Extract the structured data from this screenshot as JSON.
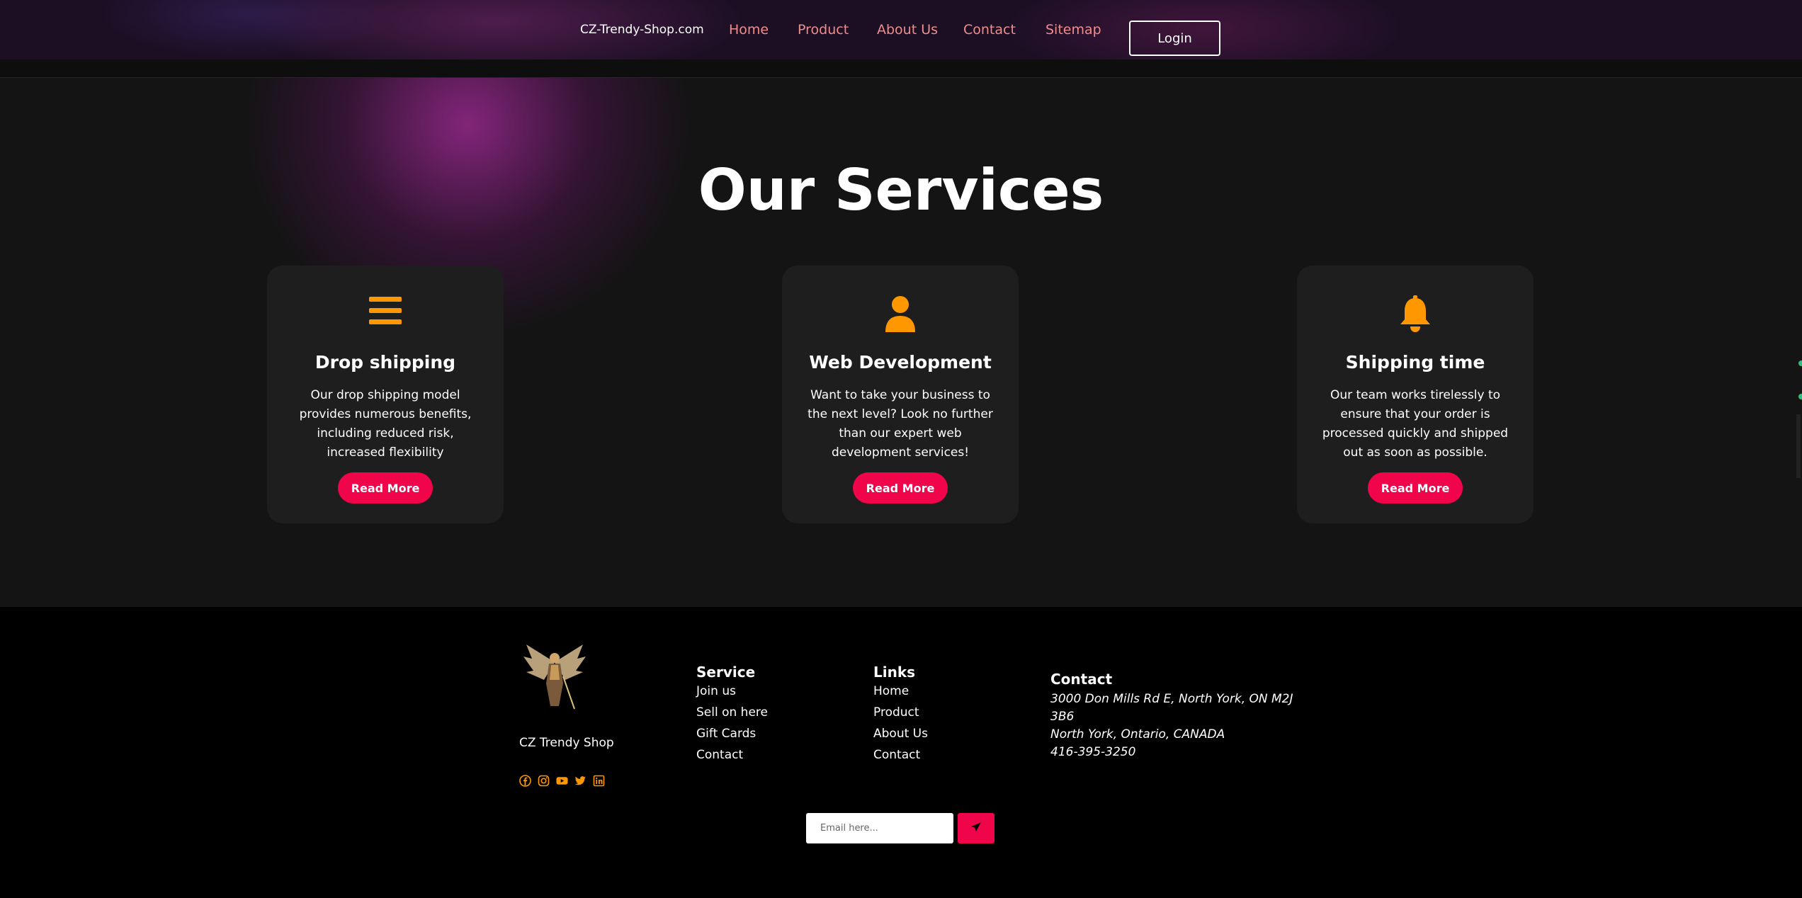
{
  "header": {
    "brand": "CZ-Trendy-Shop.com",
    "nav": [
      "Home",
      "Product",
      "About Us",
      "Contact",
      "Sitemap"
    ],
    "login_label": "Login"
  },
  "services": {
    "title": "Our Services",
    "cards": [
      {
        "icon": "menu-icon",
        "title": "Drop shipping",
        "text": "Our drop shipping model provides numerous benefits, including reduced risk, increased flexibility",
        "button": "Read More"
      },
      {
        "icon": "user-icon",
        "title": "Web Development",
        "text": "Want to take your business to the next level? Look no further than our expert web development services!",
        "button": "Read More"
      },
      {
        "icon": "bell-icon",
        "title": "Shipping time",
        "text": "Our team works tirelessly to ensure that your order is processed quickly and shipped out as soon as possible.",
        "button": "Read More"
      }
    ]
  },
  "footer": {
    "brand": "CZ Trendy Shop",
    "socials": [
      "facebook-icon",
      "instagram-icon",
      "youtube-icon",
      "twitter-icon",
      "linkedin-icon"
    ],
    "service": {
      "heading": "Service",
      "links": [
        "Join us",
        "Sell on here",
        "Gift Cards",
        "Contact"
      ]
    },
    "links": {
      "heading": "Links",
      "links": [
        "Home",
        "Product",
        "About Us",
        "Contact"
      ]
    },
    "contact": {
      "heading": "Contact",
      "address_line1": "3000 Don Mills Rd E, North York, ON M2J",
      "address_line2": "3B6",
      "address_line3": "North York, Ontario, CANADA",
      "phone": "416-395-3250"
    },
    "newsletter": {
      "placeholder": "Email here..."
    }
  },
  "colors": {
    "accent": "#f0054a",
    "icon": "#ff9800",
    "nav_link": "#f08c8c"
  }
}
